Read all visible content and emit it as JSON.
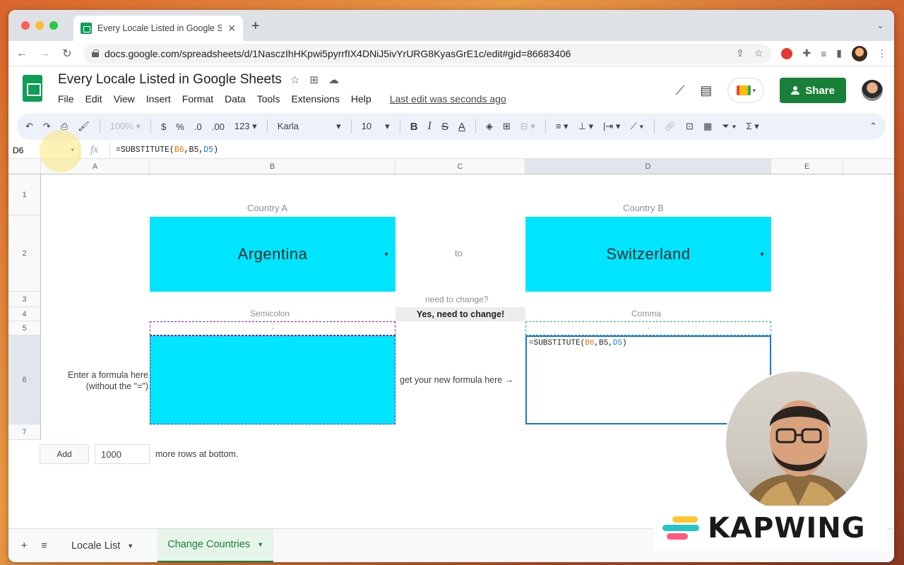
{
  "browser": {
    "tab_title": "Every Locale Listed in Google S",
    "url": "docs.google.com/spreadsheets/d/1NasczIhHKpwi5pyrrfIX4DNiJ5ivYrURG8KyasGrE1c/edit#gid=86683406"
  },
  "sheets": {
    "doc_title": "Every Locale Listed in Google Sheets",
    "menu": [
      "File",
      "Edit",
      "View",
      "Insert",
      "Format",
      "Data",
      "Tools",
      "Extensions",
      "Help"
    ],
    "last_edit": "Last edit was seconds ago",
    "share_label": "Share"
  },
  "toolbar": {
    "zoom": "100%",
    "currency": "$",
    "percent": "%",
    "dec_decrease": ".0",
    "dec_increase": ".00",
    "more_formats": "123",
    "font": "Karla",
    "font_size": "10",
    "bold": "B",
    "italic": "I",
    "strike": "S",
    "text_color": "A",
    "sum": "Σ"
  },
  "formula_bar": {
    "cell_ref": "D6",
    "fx": "fx",
    "formula_prefix": "=SUBSTITUTE(",
    "ref1": "B6",
    "comma1": ",",
    "ref2": "B5",
    "comma2": ",",
    "ref3": "D5",
    "formula_suffix": ")"
  },
  "grid": {
    "columns": [
      "A",
      "B",
      "C",
      "D",
      "E"
    ],
    "rows": [
      "1",
      "2",
      "3",
      "4",
      "5",
      "6",
      "7"
    ],
    "country_a_label": "Country A",
    "country_b_label": "Country B",
    "country_a": "Argentina",
    "country_b": "Switzerland",
    "to_label": "to",
    "need_change_q": "need to change?",
    "need_change_a": "Yes, need to change!",
    "separator_a": "Semicolon",
    "separator_b": "Comma",
    "separator_a_char": ";",
    "separator_b_char": ",",
    "enter_formula_line1": "Enter a formula here",
    "enter_formula_line2": "(without the \"=\")",
    "get_formula": "get your new formula here →",
    "result_formula_prefix": "=SUBSTITUTE(",
    "result_ref1": "B6",
    "result_ref2": "B5",
    "result_ref3": "D5",
    "result_formula_suffix": ")",
    "cyan": "#00e5ff"
  },
  "add_rows": {
    "button": "Add",
    "count": "1000",
    "suffix": "more rows at bottom."
  },
  "sheet_tabs": {
    "add": "+",
    "all_sheets": "≡",
    "tabs": [
      "Locale List",
      "Change Countries"
    ],
    "active": "Change Countries"
  },
  "watermark": {
    "brand": "KAPWING"
  },
  "colors": {
    "sheets_green": "#188038",
    "selection_blue": "#1a73e8"
  }
}
